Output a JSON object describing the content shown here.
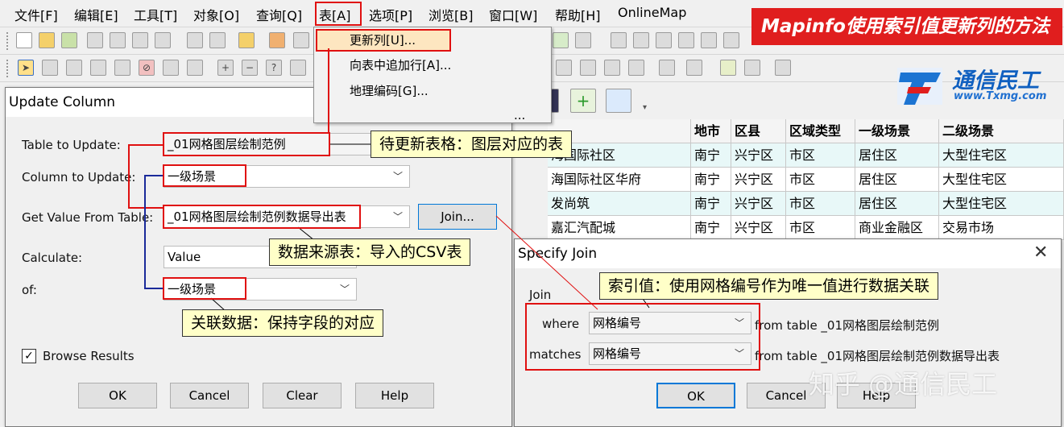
{
  "menubar": {
    "items": [
      "文件[F]",
      "编辑[E]",
      "工具[T]",
      "对象[O]",
      "查询[Q]",
      "表[A]",
      "选项[P]",
      "浏览[B]",
      "窗口[W]",
      "帮助[H]",
      "OnlineMap"
    ]
  },
  "banner": {
    "text": "Mapinfo使用索引值更新列的方法"
  },
  "logo": {
    "name": "通信民工",
    "url": "www.Txmg.com"
  },
  "table_menu": {
    "items": [
      "更新列[U]...",
      "向表中追加行[A]...",
      "地理编码[G]..."
    ],
    "trailing_item": "..."
  },
  "browser": {
    "headers": [
      "地市",
      "区县",
      "区域类型",
      "一级场景",
      "二级场景"
    ],
    "rows": [
      {
        "name": "海国际社区",
        "city": "南宁",
        "county": "兴宁区",
        "type": "市区",
        "scene1": "居住区",
        "scene2": "大型住宅区"
      },
      {
        "name": "海国际社区华府",
        "city": "南宁",
        "county": "兴宁区",
        "type": "市区",
        "scene1": "居住区",
        "scene2": "大型住宅区"
      },
      {
        "name": "发尚筑",
        "city": "南宁",
        "county": "兴宁区",
        "type": "市区",
        "scene1": "居住区",
        "scene2": "大型住宅区"
      },
      {
        "name": "嘉汇汽配城",
        "city": "南宁",
        "county": "兴宁区",
        "type": "市区",
        "scene1": "商业金融区",
        "scene2": "交易市场"
      }
    ]
  },
  "update_column": {
    "title": "Update Column",
    "table_to_update_label": "Table to Update:",
    "table_to_update_value": "_01网格图层绘制范例",
    "column_to_update_label": "Column to Update:",
    "column_to_update_value": "一级场景",
    "get_value_label": "Get Value From Table:",
    "get_value_value": "_01网格图层绘制范例数据导出表",
    "join_button": "Join...",
    "calculate_label": "Calculate:",
    "calculate_value": "Value",
    "of_label": "of:",
    "of_value": "一级场景",
    "browse_results": "Browse Results",
    "browse_checked": true,
    "buttons": {
      "ok": "OK",
      "cancel": "Cancel",
      "clear": "Clear",
      "help": "Help"
    }
  },
  "specify_join": {
    "title": "Specify Join",
    "group_label": "Join",
    "where_label": "where",
    "where_value": "网格编号",
    "where_from": "from table _01网格图层绘制范例",
    "matches_label": "matches",
    "matches_value": "网格编号",
    "matches_from": "from table _01网格图层绘制范例数据导出表",
    "buttons": {
      "ok": "OK",
      "cancel": "Cancel",
      "help": "Help"
    }
  },
  "callouts": {
    "table_to_update": "待更新表格：图层对应的表",
    "source_table": "数据来源表：导入的CSV表",
    "related_data": "关联数据：保持字段的对应",
    "index_value": "索引值：使用网格编号作为唯一值进行数据关联"
  },
  "watermark": "知乎 @通信民工",
  "colors": {
    "annotation_red": "#e01010",
    "banner_red": "#e01e1e",
    "callout_yellow": "#ffffc8",
    "connector_blue": "#1a2a9a"
  }
}
